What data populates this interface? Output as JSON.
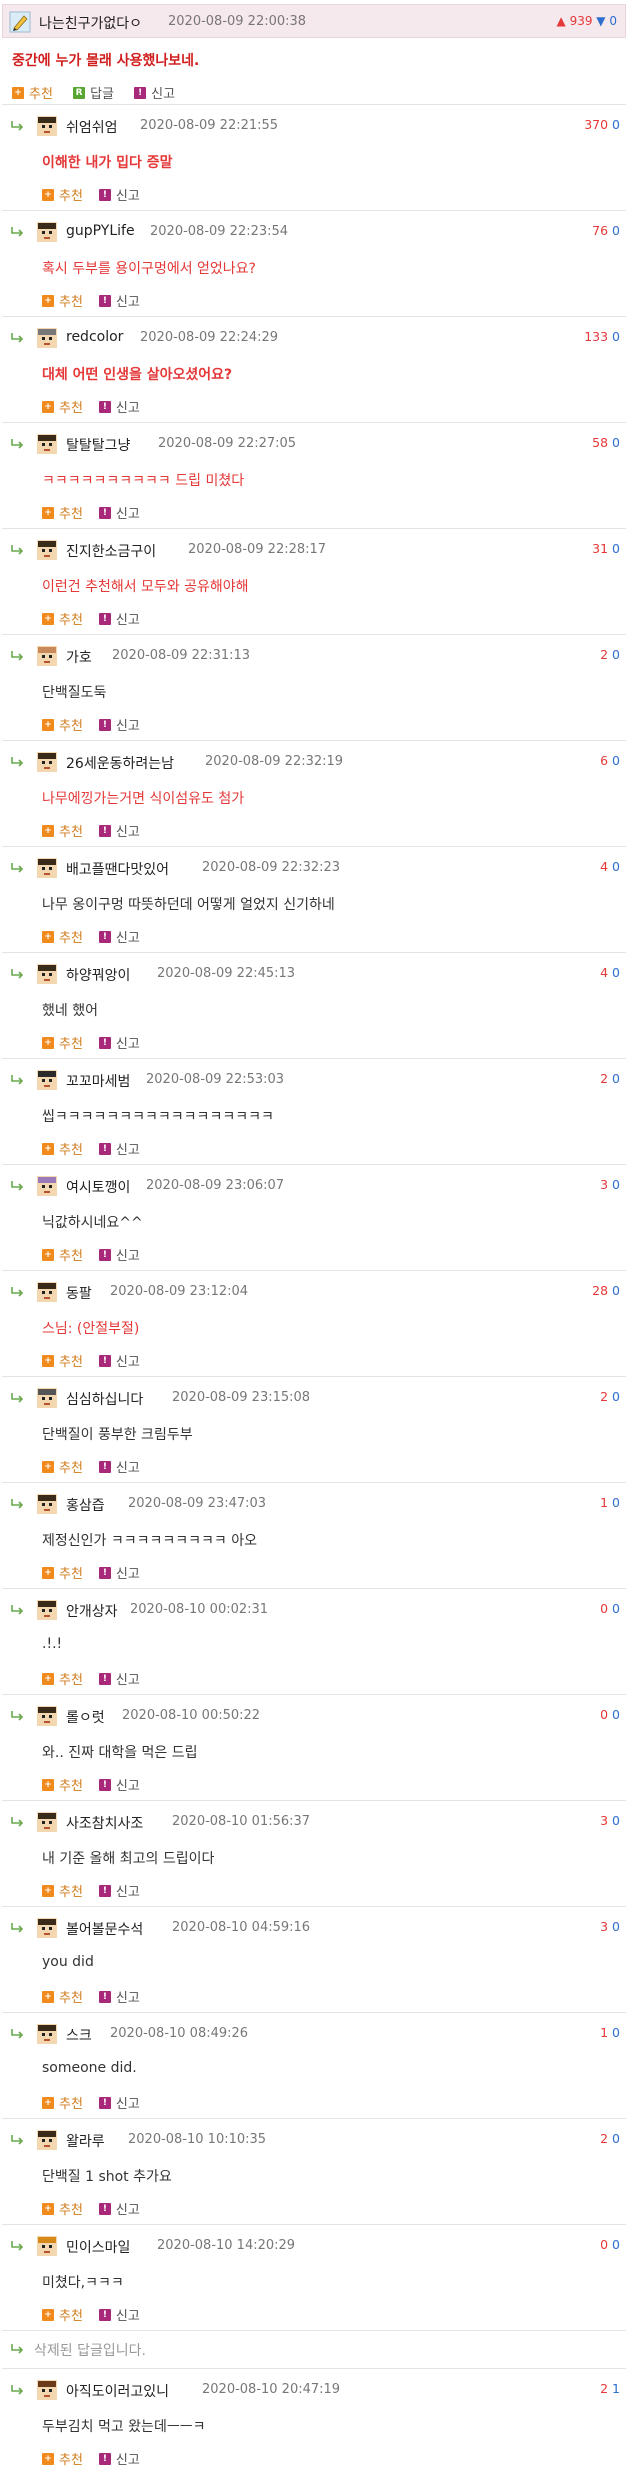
{
  "post": {
    "nick": "나는친구가없다ㅇ",
    "date": "2020-08-09 22:00:38",
    "up": "939",
    "down": "0",
    "body": "중간에 누가 몰래 사용했나보네.",
    "recommend": "추천",
    "reply": "답글",
    "report": "신고"
  },
  "labels": {
    "recommend": "추천",
    "report": "신고",
    "deleted": "삭제된 답글입니다."
  },
  "comments": [
    {
      "nick": "쉬엄쉬엄",
      "date": "2020-08-09 22:21:55",
      "up": "370",
      "down": "0",
      "text": "이해한 내가 밉다 증말",
      "style": "bold"
    },
    {
      "nick": "gupPYLife",
      "date": "2020-08-09 22:23:54",
      "up": "76",
      "down": "0",
      "text": "혹시 두부를 용이구멍에서 얻었나요?",
      "style": "red"
    },
    {
      "nick": "redcolor",
      "date": "2020-08-09 22:24:29",
      "up": "133",
      "down": "0",
      "text": "대체 어떤 인생을 살아오셨어요?",
      "style": "bold"
    },
    {
      "nick": "탈탈탈그냥",
      "date": "2020-08-09 22:27:05",
      "up": "58",
      "down": "0",
      "text": "ㅋㅋㅋㅋㅋㅋㅋㅋㅋㅋ 드립 미쳤다",
      "style": "red"
    },
    {
      "nick": "진지한소금구이",
      "date": "2020-08-09 22:28:17",
      "up": "31",
      "down": "0",
      "text": "이런건 추천해서 모두와 공유해야해",
      "style": "red"
    },
    {
      "nick": "가호",
      "date": "2020-08-09 22:31:13",
      "up": "2",
      "down": "0",
      "text": "단백질도둑",
      "style": "normal"
    },
    {
      "nick": "26세운동하려는남",
      "date": "2020-08-09 22:32:19",
      "up": "6",
      "down": "0",
      "text": "나무에낑가는거면 식이섬유도 첨가",
      "style": "red"
    },
    {
      "nick": "배고플땐다맛있어",
      "date": "2020-08-09 22:32:23",
      "up": "4",
      "down": "0",
      "text": "나무 옹이구멍 따뜻하던데 어떻게 얼었지 신기하네",
      "style": "normal"
    },
    {
      "nick": "하양꿔앙이",
      "date": "2020-08-09 22:45:13",
      "up": "4",
      "down": "0",
      "text": "했네 했어",
      "style": "normal"
    },
    {
      "nick": "꼬꼬마세범",
      "date": "2020-08-09 22:53:03",
      "up": "2",
      "down": "0",
      "text": "씹ㅋㅋㅋㅋㅋㅋㅋㅋㅋㅋㅋㅋㅋㅋㅋㅋㅋ",
      "style": "normal"
    },
    {
      "nick": "여시토깽이",
      "date": "2020-08-09 23:06:07",
      "up": "3",
      "down": "0",
      "text": "닉값하시네요^^",
      "style": "normal"
    },
    {
      "nick": "동팔",
      "date": "2020-08-09 23:12:04",
      "up": "28",
      "down": "0",
      "text": "스님: (안절부절)",
      "style": "red"
    },
    {
      "nick": "심심하십니다",
      "date": "2020-08-09 23:15:08",
      "up": "2",
      "down": "0",
      "text": "단백질이 풍부한 크림두부",
      "style": "normal"
    },
    {
      "nick": "홍삼즙",
      "date": "2020-08-09 23:47:03",
      "up": "1",
      "down": "0",
      "text": "제정신인가 ㅋㅋㅋㅋㅋㅋㅋㅋㅋ 아오",
      "style": "normal"
    },
    {
      "nick": "안개상자",
      "date": "2020-08-10 00:02:31",
      "up": "0",
      "down": "0",
      "text": ".!.!",
      "style": "normal"
    },
    {
      "nick": "롤ㅇ럿",
      "date": "2020-08-10 00:50:22",
      "up": "0",
      "down": "0",
      "text": "와.. 진짜 대학을 먹은 드립",
      "style": "normal"
    },
    {
      "nick": "사조참치사조",
      "date": "2020-08-10 01:56:37",
      "up": "3",
      "down": "0",
      "text": "내 기준 올해 최고의 드립이다",
      "style": "normal"
    },
    {
      "nick": "볼어볼문수석",
      "date": "2020-08-10 04:59:16",
      "up": "3",
      "down": "0",
      "text": "you did",
      "style": "normal"
    },
    {
      "nick": "스크",
      "date": "2020-08-10 08:49:26",
      "up": "1",
      "down": "0",
      "text": "someone did.",
      "style": "normal"
    },
    {
      "nick": "왈라루",
      "date": "2020-08-10 10:10:35",
      "up": "2",
      "down": "0",
      "text": "단백질 1 shot 추가요",
      "style": "normal"
    },
    {
      "nick": "민이스마일",
      "date": "2020-08-10 14:20:29",
      "up": "0",
      "down": "0",
      "text": "미쳤다,ㅋㅋㅋ",
      "style": "normal"
    },
    {
      "nick": "아직도이러고있니",
      "date": "2020-08-10 20:47:19",
      "up": "2",
      "down": "1",
      "text": "두부김치 먹고 왔는데ㅡㅡㅋ",
      "style": "normal"
    }
  ],
  "colors": {
    "accent_red": "#e53838",
    "accent_blue": "#2d6ecf",
    "recommend_orange": "#f08a1c",
    "report_purple": "#a8287a"
  }
}
